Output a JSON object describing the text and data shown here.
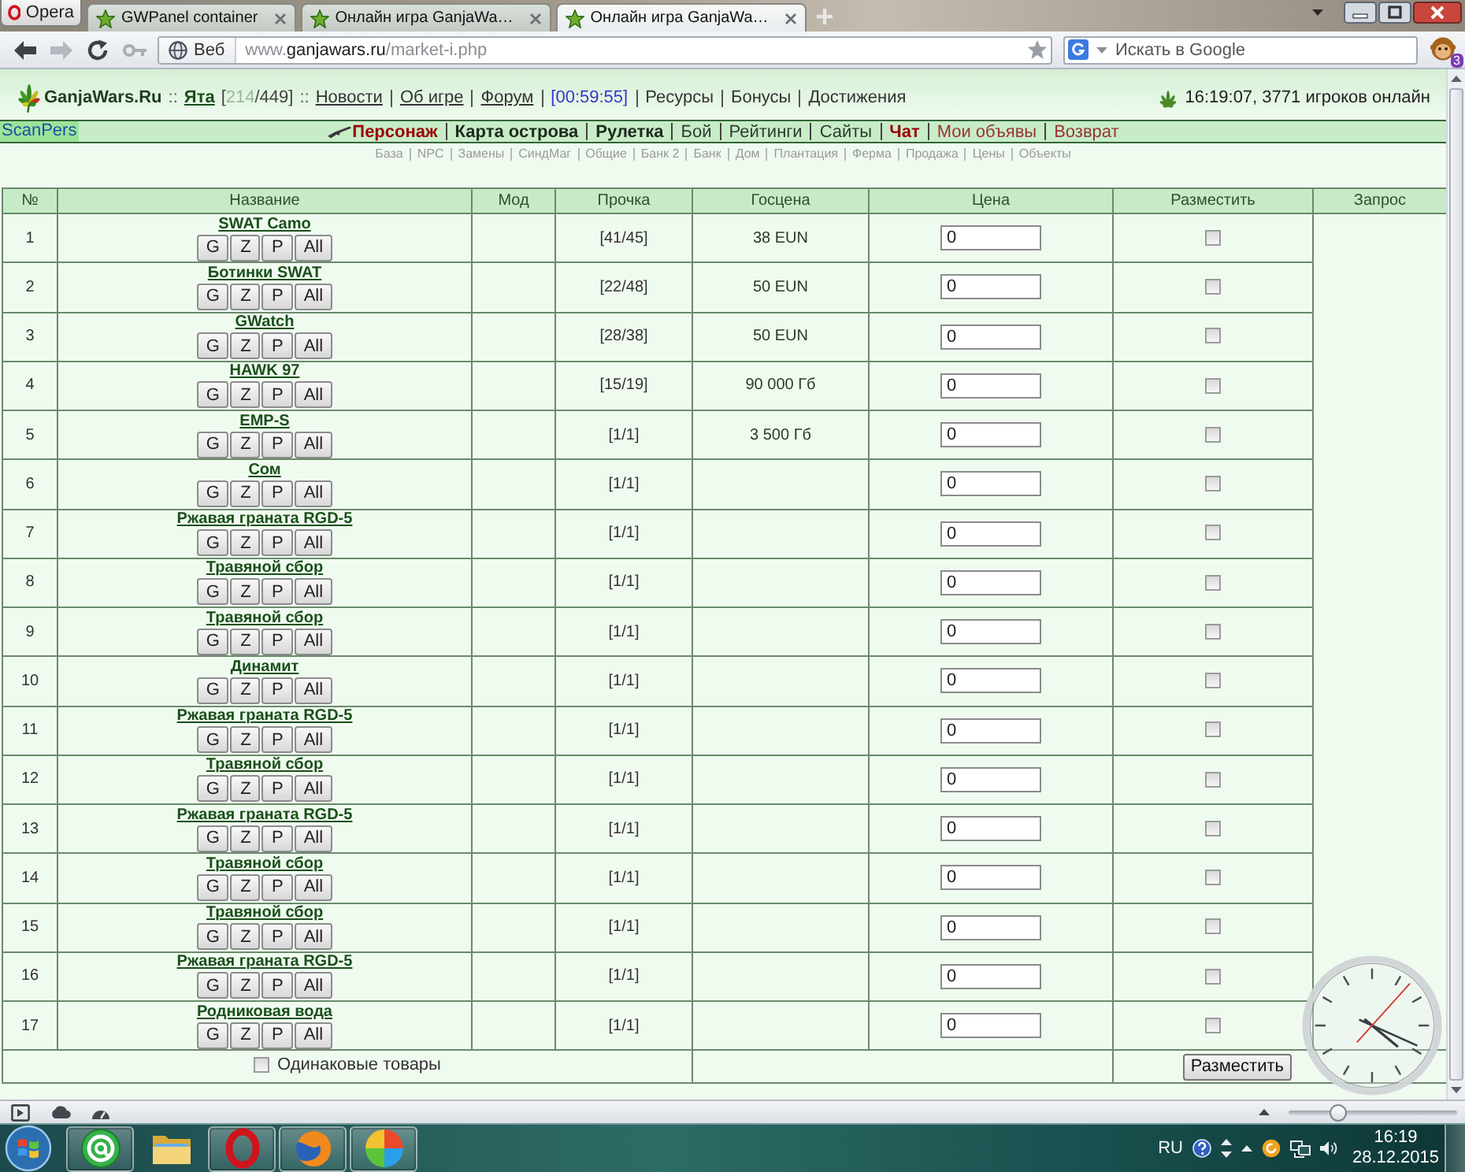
{
  "browser": {
    "menu_button": "Opera",
    "tabs": [
      {
        "title": "GWPanel container",
        "selected": false
      },
      {
        "title": "Онлайн игра GanjaWa…",
        "selected": false
      },
      {
        "title": "Онлайн игра GanjaWa…",
        "selected": true
      }
    ],
    "address": {
      "badge": "Веб",
      "url_prefix": "www.",
      "url_host": "ganjawars.ru",
      "url_path": "/market-i.php"
    },
    "search": {
      "placeholder": "Искать в Google"
    },
    "extension_badge": "3"
  },
  "header": {
    "brand": "GanjaWars.Ru",
    "separators": [
      "::",
      "::"
    ],
    "player": "Ята",
    "health_open": "[",
    "health_current": "214",
    "health_rest": "/449]",
    "links": [
      {
        "label": "Новости",
        "kind": "link"
      },
      {
        "label": "Об игре",
        "kind": "link"
      },
      {
        "label": "Форум",
        "kind": "link"
      },
      {
        "label": "[00:59:55]",
        "kind": "timer"
      },
      {
        "label": "Ресурсы",
        "kind": "plain"
      },
      {
        "label": "Бонусы",
        "kind": "plain"
      },
      {
        "label": "Достижения",
        "kind": "plain"
      }
    ],
    "online": "16:19:07, 3771 игроков онлайн"
  },
  "nav": {
    "side_link": "ScanPers",
    "items": [
      {
        "label": "Персонаж",
        "kind": "strong",
        "color": "#990000"
      },
      {
        "label": "Карта острова",
        "kind": "strong",
        "color": "#1e2a1e"
      },
      {
        "label": "Рулетка",
        "kind": "strong",
        "color": "#1e2a1e"
      },
      {
        "label": "Бой",
        "kind": "plain",
        "color": "#2e3b2e"
      },
      {
        "label": "Рейтинги",
        "kind": "plain",
        "color": "#2e3b2e"
      },
      {
        "label": "Сайты",
        "kind": "plain",
        "color": "#2e3b2e"
      },
      {
        "label": "Чат",
        "kind": "strong",
        "color": "#990000"
      },
      {
        "label": "Мои объявы",
        "kind": "plain",
        "color": "#993333"
      },
      {
        "label": "Возврат",
        "kind": "plain",
        "color": "#993333"
      }
    ]
  },
  "subnav": {
    "items": [
      "База",
      "NPC",
      "Замены",
      "СиндМаг",
      "Общие",
      "Банк 2",
      "Банк",
      "Дом",
      "Плантация",
      "Ферма",
      "Продажа",
      "Цены",
      "Объекты"
    ]
  },
  "table": {
    "columns": [
      "№",
      "Название",
      "Мод",
      "Прочка",
      "Госцена",
      "Цена",
      "Разместить",
      "Запрос"
    ],
    "rows": [
      {
        "number": "1",
        "name": "SWAT Camo",
        "actions": [
          "G",
          "Z",
          "P",
          "All"
        ],
        "durability": "[41/45]",
        "state_price": "38 EUN",
        "price": "0",
        "checked": false
      },
      {
        "number": "2",
        "name": "Ботинки SWAT",
        "actions": [
          "G",
          "Z",
          "P",
          "All"
        ],
        "durability": "[22/48]",
        "state_price": "50 EUN",
        "price": "0",
        "checked": false
      },
      {
        "number": "3",
        "name": "GWatch",
        "actions": [
          "G",
          "Z",
          "P",
          "All"
        ],
        "durability": "[28/38]",
        "state_price": "50 EUN",
        "price": "0",
        "checked": false
      },
      {
        "number": "4",
        "name": "HAWK 97",
        "actions": [
          "G",
          "Z",
          "P",
          "All"
        ],
        "durability": "[15/19]",
        "state_price": "90 000 Гб",
        "price": "0",
        "checked": false
      },
      {
        "number": "5",
        "name": "EMP-S",
        "actions": [
          "G",
          "Z",
          "P",
          "All"
        ],
        "durability": "[1/1]",
        "state_price": "3 500 Гб",
        "price": "0",
        "checked": false
      },
      {
        "number": "6",
        "name": "Сом",
        "actions": [
          "G",
          "Z",
          "P",
          "All"
        ],
        "durability": "[1/1]",
        "price": "0",
        "checked": false
      },
      {
        "number": "7",
        "name": "Ржавая граната RGD-5",
        "actions": [
          "G",
          "Z",
          "P",
          "All"
        ],
        "durability": "[1/1]",
        "price": "0",
        "checked": false
      },
      {
        "number": "8",
        "name": "Травяной сбор",
        "actions": [
          "G",
          "Z",
          "P",
          "All"
        ],
        "durability": "[1/1]",
        "price": "0",
        "checked": false
      },
      {
        "number": "9",
        "name": "Травяной сбор",
        "actions": [
          "G",
          "Z",
          "P",
          "All"
        ],
        "durability": "[1/1]",
        "price": "0",
        "checked": false
      },
      {
        "number": "10",
        "name": "Динамит",
        "actions": [
          "G",
          "Z",
          "P",
          "All"
        ],
        "durability": "[1/1]",
        "price": "0",
        "checked": false
      },
      {
        "number": "11",
        "name": "Ржавая граната RGD-5",
        "actions": [
          "G",
          "Z",
          "P",
          "All"
        ],
        "durability": "[1/1]",
        "price": "0",
        "checked": false
      },
      {
        "number": "12",
        "name": "Травяной сбор",
        "actions": [
          "G",
          "Z",
          "P",
          "All"
        ],
        "durability": "[1/1]",
        "price": "0",
        "checked": false
      },
      {
        "number": "13",
        "name": "Ржавая граната RGD-5",
        "actions": [
          "G",
          "Z",
          "P",
          "All"
        ],
        "durability": "[1/1]",
        "price": "0",
        "checked": false
      },
      {
        "number": "14",
        "name": "Травяной сбор",
        "actions": [
          "G",
          "Z",
          "P",
          "All"
        ],
        "durability": "[1/1]",
        "price": "0",
        "checked": false
      },
      {
        "number": "15",
        "name": "Травяной сбор",
        "actions": [
          "G",
          "Z",
          "P",
          "All"
        ],
        "durability": "[1/1]",
        "price": "0",
        "checked": false
      },
      {
        "number": "16",
        "name": "Ржавая граната RGD-5",
        "actions": [
          "G",
          "Z",
          "P",
          "All"
        ],
        "durability": "[1/1]",
        "price": "0",
        "checked": false
      },
      {
        "number": "17",
        "name": "Родниковая вода",
        "actions": [
          "G",
          "Z",
          "P",
          "All"
        ],
        "durability": "[1/1]",
        "price": "0",
        "checked": false
      }
    ],
    "footer": {
      "same_items_label": "Одинаковые товары",
      "same_items_checked": false,
      "submit": "Разместить"
    }
  },
  "status_bar": {
    "zoom_slider": {
      "level": 0.27
    }
  },
  "taskbar": {
    "apps": [
      {
        "kind": "mail",
        "running": true
      },
      {
        "kind": "folder",
        "running": false
      },
      {
        "kind": "opera",
        "running": true
      },
      {
        "kind": "firefox",
        "running": true
      },
      {
        "kind": "pinwheel",
        "running": true
      }
    ],
    "language": "RU",
    "time": "16:19",
    "date": "28.12.2015"
  }
}
